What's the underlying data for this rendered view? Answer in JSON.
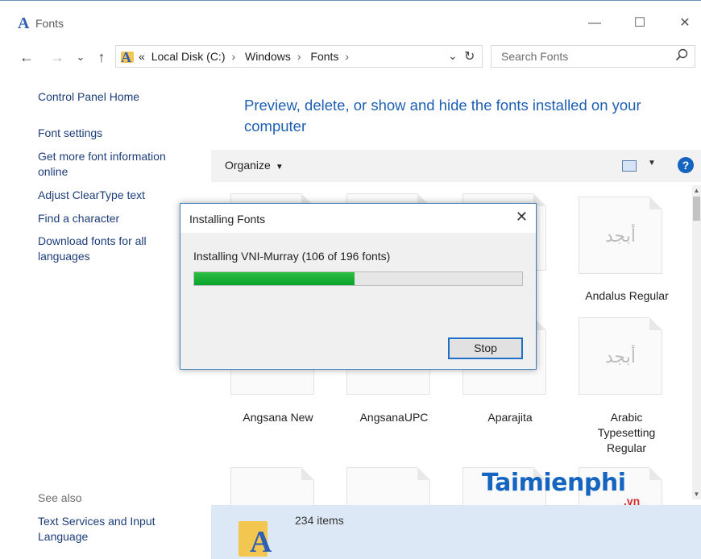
{
  "window": {
    "title": "Fonts",
    "minimize_glyph": "—",
    "maximize_glyph": "☐",
    "close_glyph": "✕"
  },
  "nav": {
    "back": "←",
    "forward": "→",
    "recent": "⌄",
    "up": "↑",
    "dropdown": "⌄",
    "refresh": "↻"
  },
  "address": {
    "overflow": "«",
    "crumbs": [
      "Local Disk (C:)",
      "Windows",
      "Fonts"
    ],
    "separator": "›"
  },
  "search": {
    "placeholder": "Search Fonts",
    "icon": "search-icon"
  },
  "left_pane": {
    "links": [
      "Control Panel Home",
      "Font settings",
      "Get more font information online",
      "Adjust ClearType text",
      "Find a character",
      "Download fonts for all languages"
    ],
    "see_also_title": "See also",
    "see_also_links": [
      "Text Services and Input Language"
    ]
  },
  "heading": "Preview, delete, or show and hide the fonts installed on your computer",
  "toolbar": {
    "organize": "Organize",
    "caret": "▼",
    "help": "?"
  },
  "fonts": {
    "partial_label_1": "ular",
    "row1_right": {
      "glyph": "أبجد",
      "label": "Andalus Regular"
    },
    "row2": [
      {
        "label": "Angsana New"
      },
      {
        "label": "AngsanaUPC"
      },
      {
        "label": "Aparajita"
      },
      {
        "glyph": "أبجد",
        "label": "Arabic Typesetting Regular"
      }
    ]
  },
  "dialog": {
    "title": "Installing Fonts",
    "message": "Installing VNI-Murray (106 of 196 fonts)",
    "progress_fraction": 0.49,
    "stop_label": "Stop",
    "close_glyph": "✕"
  },
  "status": {
    "count": "234 items"
  },
  "watermark": {
    "text": "Taimienphi",
    "sub": ".vn"
  },
  "colors": {
    "link": "#1c3d7a",
    "heading": "#1e5fb3",
    "progress": "#08a32a",
    "status_bg": "#dce8f5",
    "help": "#1565c0"
  }
}
